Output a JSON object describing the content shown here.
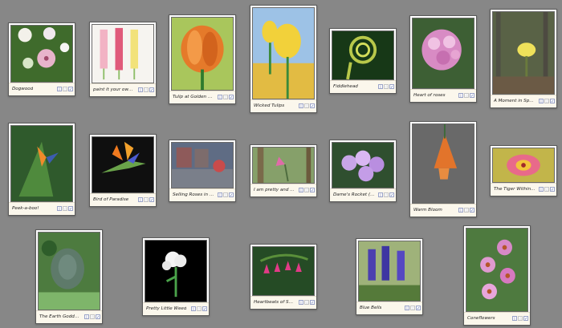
{
  "icons": {
    "info": "i",
    "favorite": "☆",
    "select": "✓"
  },
  "gallery": [
    {
      "title": "Dogwood"
    },
    {
      "title": "paint it your own way"
    },
    {
      "title": "Tulip at Golden Hour"
    },
    {
      "title": "Wicked Tulips"
    },
    {
      "title": "Fiddlehead"
    },
    {
      "title": "Heart of roses"
    },
    {
      "title": "A Moment in Spring"
    },
    {
      "title": "Peek-a-boo!"
    },
    {
      "title": "Bird of Paradise"
    },
    {
      "title": "Selling Roses in the rain"
    },
    {
      "title": "I am pretty and I kno..."
    },
    {
      "title": "Dame's Rocket (Hespe..."
    },
    {
      "title": "Warm Bloom"
    },
    {
      "title": "The Tiger Within the L..."
    },
    {
      "title": "The Earth Goddess"
    },
    {
      "title": "Pretty Little Weed"
    },
    {
      "title": "Heartbeats of Spring"
    },
    {
      "title": "Blue Bells"
    },
    {
      "title": "Coneflowers"
    }
  ]
}
